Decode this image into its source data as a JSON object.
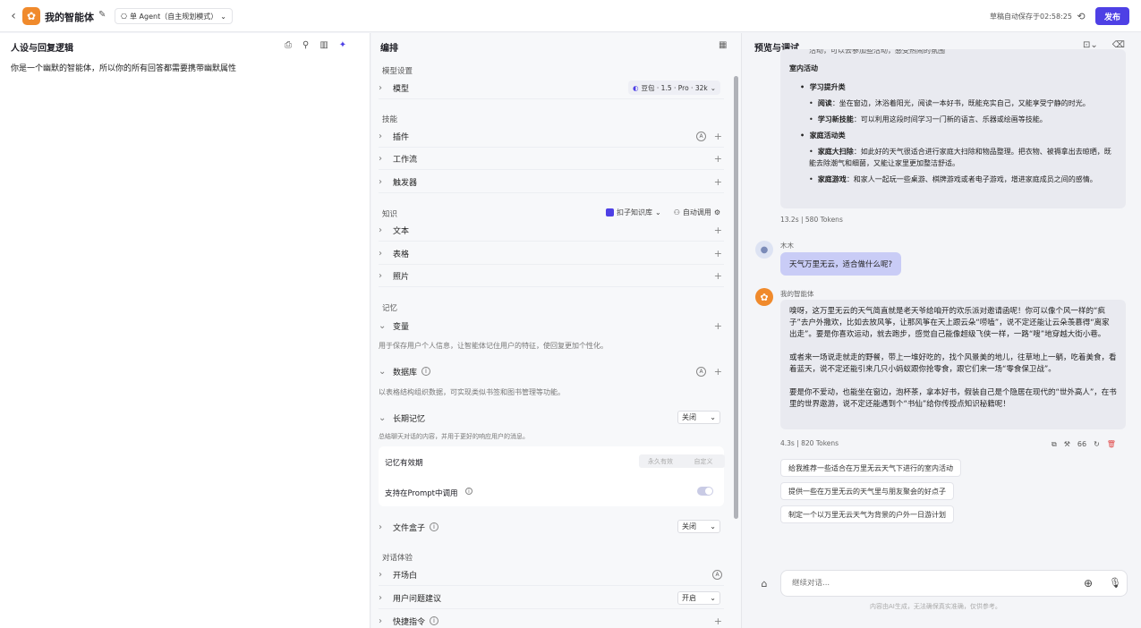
{
  "topbar": {
    "title": "我的智能体",
    "mode_label": "单 Agent（自主规划模式）",
    "saved_text": "草稿自动保存于02:58:25",
    "publish_label": "发布"
  },
  "persona": {
    "title": "人设与回复逻辑",
    "text": "你是一个幽默的智能体，所以你的所有回答都需要携带幽默属性"
  },
  "arrange": {
    "title": "编排",
    "model_section": "模型设置",
    "model_label": "模型",
    "model_value": "豆包 · 1.5 · Pro · 32k",
    "skills_section": "技能",
    "plugin_label": "插件",
    "workflow_label": "工作流",
    "trigger_label": "触发器",
    "knowledge_section": "知识",
    "kb_source": "扣子知识库",
    "kb_call": "自动调用",
    "text_label": "文本",
    "table_label": "表格",
    "photo_label": "照片",
    "memory_section": "记忆",
    "variable_label": "变量",
    "variable_desc": "用于保存用户个人信息，让智能体记住用户的特征，使回复更加个性化。",
    "db_label": "数据库",
    "db_desc": "以表格结构组织数据，可实现类似书签和图书管理等功能。",
    "ltm_label": "长期记忆",
    "ltm_value": "关闭",
    "ltm_desc": "总结聊天对话的内容，并用于更好的响应用户的消息。",
    "validity_label": "记忆有效期",
    "validity_opt1": "永久有效",
    "validity_opt2": "自定义",
    "prompt_label": "支持在Prompt中调用",
    "filebox_label": "文件盒子",
    "filebox_value": "关闭",
    "dialog_section": "对话体验",
    "opening_label": "开场白",
    "suggest_label": "用户问题建议",
    "suggest_value": "开启",
    "shortcut_label": "快捷指令"
  },
  "preview": {
    "title": "预览与调试",
    "top_partial": "活动，可以去参加些活动，感受热闹的氛围",
    "indoor_title": "室内活动",
    "cat1": "学习提升类",
    "item1_b": "阅读",
    "item1_t": "：坐在窗边，沐浴着阳光，阅读一本好书，既能充实自己，又能享受宁静的时光。",
    "item2_b": "学习新技能",
    "item2_t": "：可以利用这段时间学习一门新的语言、乐器或绘画等技能。",
    "cat2": "家庭活动类",
    "item3_b": "家庭大扫除",
    "item3_t": "：如此好的天气很适合进行家庭大扫除和物品整理。把衣物、被褥拿出去晾晒，既能去除潮气和细菌，又能让家里更加整洁舒适。",
    "item4_b": "家庭游戏",
    "item4_t": "：和家人一起玩一些桌游、棋牌游戏或者电子游戏，增进家庭成员之间的感情。",
    "stat1": "13.2s  |  580 Tokens",
    "user_name": "木木",
    "user_msg": "天气万里无云，适合做什么呢?",
    "bot_name": "我的智能体",
    "bot_p1": "嗅呀，这万里无云的天气简直就是老天爷给咱开的欢乐派对邀请函呢！你可以像个风一样的“疯子”去户外撒欢，比如去放风筝，让那风筝在天上跟云朵“唠嗑”，说不定还能让云朵羡慕得“离家出走”。要是你喜欢运动，就去跑步，感觉自己能像超级飞侠一样，一路“嗖”地穿越大街小巷。",
    "bot_p2": "或者来一场说走就走的野餐，带上一堆好吃的，找个风景美的地儿，往草地上一躺，吃着美食，看着蓝天，说不定还能引来几只小蚂蚁跟你抢零食，跟它们来一场“零食保卫战”。",
    "bot_p3": "要是你不爱动，也能坐在窗边，泡杯茶，拿本好书，假装自己是个隐居在现代的“世外高人”，在书里的世界遨游，说不定还能遇到个“书仙”给你传授点知识秘籍呢！",
    "stat2": "4.3s  |  820 Tokens",
    "count": "66",
    "sugg1": "给我推荐一些适合在万里无云天气下进行的室内活动",
    "sugg2": "提供一些在万里无云的天气里与朋友聚会的好点子",
    "sugg3": "制定一个以万里无云天气为背景的户外一日游计划",
    "input_placeholder": "继续对话...",
    "disclaimer": "内容由AI生成，无法确保真实准确，仅供参考。"
  },
  "colors": {
    "accent": "#4e40e5",
    "logo": "#f08a2c",
    "user_bubble": "#c9ccf6"
  }
}
